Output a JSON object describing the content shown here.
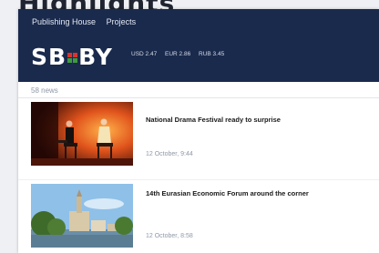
{
  "page": {
    "cut_heading": "Highlights"
  },
  "header": {
    "nav": [
      "Publishing House",
      "Projects"
    ],
    "logo": {
      "left": "SB",
      "right": "BY"
    },
    "rates": [
      "USD 2.47",
      "EUR 2.86",
      "RUB 3.45"
    ]
  },
  "news": {
    "count": "58 news",
    "items": [
      {
        "title": "National Drama Festival ready to surprise",
        "date": "12 October, 9:44"
      },
      {
        "title": "14th Eurasian Economic Forum around the corner",
        "date": "12 October, 8:58"
      }
    ]
  },
  "colors": {
    "header_bg": "#1a2a4d",
    "logo_red": "#d9332f",
    "logo_green": "#3f9b3e"
  }
}
